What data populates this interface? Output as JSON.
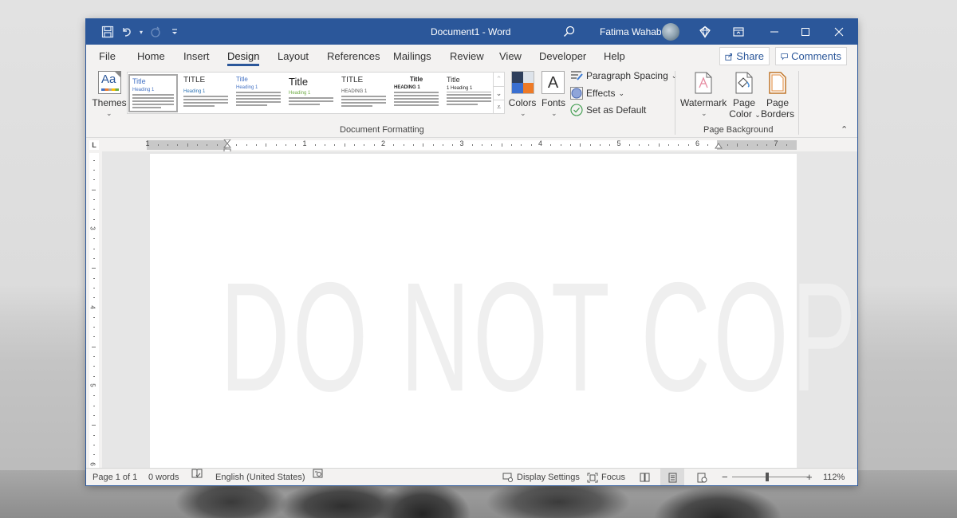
{
  "window": {
    "title": "Document1  -  Word",
    "user_name": "Fatima Wahab"
  },
  "quick_access": [
    {
      "name": "save",
      "icon": "save-icon"
    },
    {
      "name": "undo",
      "icon": "undo-icon"
    },
    {
      "name": "redo",
      "icon": "redo-icon"
    },
    {
      "name": "customize",
      "icon": "customize-qat-icon"
    }
  ],
  "title_controls": {
    "search_icon": "search-icon",
    "premium_icon": "diamond-icon",
    "ribbon_display_icon": "ribbon-display-icon",
    "minimize": "—",
    "maximize": "☐",
    "close": "✕"
  },
  "tabs": [
    {
      "label": "File"
    },
    {
      "label": "Home"
    },
    {
      "label": "Insert"
    },
    {
      "label": "Design",
      "active": true
    },
    {
      "label": "Layout"
    },
    {
      "label": "References"
    },
    {
      "label": "Mailings"
    },
    {
      "label": "Review"
    },
    {
      "label": "View"
    },
    {
      "label": "Developer"
    },
    {
      "label": "Help"
    }
  ],
  "tab_actions": {
    "share": "Share",
    "comments": "Comments"
  },
  "ribbon": {
    "themes_label": "Themes",
    "style_gallery": [
      {
        "title": "Title",
        "heading": "Heading 1",
        "selected": true
      },
      {
        "title": "TITLE",
        "heading": "Heading 1"
      },
      {
        "title": "Title",
        "heading": "Heading 1"
      },
      {
        "title": "Title",
        "heading": "Heading 1"
      },
      {
        "title": "TITLE",
        "heading": "HEADING 1"
      },
      {
        "title": "Title",
        "heading": "HEADING 1"
      },
      {
        "title": "Title",
        "heading": "1  Heading 1"
      }
    ],
    "colors_label": "Colors",
    "fonts_label": "Fonts",
    "fonts_glyph": "A",
    "paragraph_spacing_label": "Paragraph Spacing",
    "effects_label": "Effects",
    "set_default_label": "Set as Default",
    "document_formatting_group": "Document Formatting",
    "watermark_label": "Watermark",
    "page_color_label_1": "Page",
    "page_color_label_2": "Color",
    "page_borders_label_1": "Page",
    "page_borders_label_2": "Borders",
    "page_background_group": "Page Background",
    "theme_colors": [
      "#2e3f5c",
      "#dde3ea",
      "#3a6fd0",
      "#ee7a26"
    ]
  },
  "ruler": {
    "horizontal_numbers": [
      "1",
      "1",
      "2",
      "3",
      "4",
      "5",
      "6",
      "7"
    ],
    "vertical_numbers": [
      "3",
      "4",
      "5",
      "6"
    ],
    "tab_selector": "L"
  },
  "document": {
    "watermark_text": "DO NOT COPY"
  },
  "statusbar": {
    "page": "Page 1 of 1",
    "words": "0 words",
    "language": "English (United States)",
    "display_settings": "Display Settings",
    "focus": "Focus",
    "zoom_minus": "−",
    "zoom_plus": "+",
    "zoom_level": "112%",
    "zoom_percent": 112
  },
  "colors": {
    "accent": "#2b579a",
    "ribbon_bg": "#f3f2f1"
  }
}
